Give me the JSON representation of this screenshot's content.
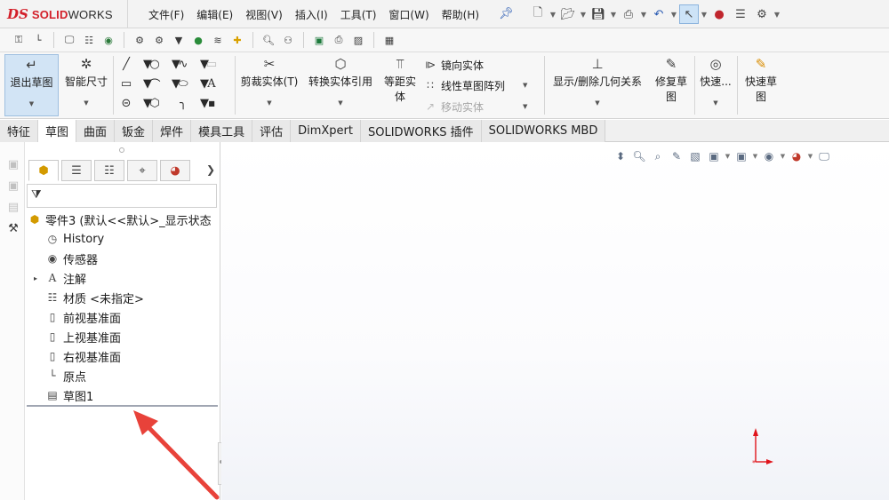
{
  "app": {
    "logo_ds": "DS",
    "logo_name_a": "SOLID",
    "logo_name_b": "WORKS"
  },
  "menu": [
    "文件(F)",
    "编辑(E)",
    "视图(V)",
    "插入(I)",
    "工具(T)",
    "窗口(W)",
    "帮助(H)"
  ],
  "quick_access_icons": [
    "new-icon",
    "open-icon",
    "save-icon",
    "print-icon",
    "undo-icon",
    "select-icon",
    "rebuild-icon",
    "file-properties-icon",
    "options-icon"
  ],
  "ribbon": {
    "exit_sketch": "退出草图",
    "smart_dimension": "智能尺寸",
    "trim_entities": "剪裁实体(T)",
    "convert_entities": "转换实体引用",
    "offset_entities": "等距实",
    "offset_entities_line2": "体",
    "mirror_entities": "镜向实体",
    "linear_pattern": "线性草图阵列",
    "move_entities": "移动实体",
    "display_delete_relations": "显示/删除几何关系",
    "repair_sketch": "修复草",
    "repair_sketch_line2": "图",
    "quick_snaps": "快速...",
    "rapid_sketch": "快速草",
    "rapid_sketch_line2": "图"
  },
  "tabs": [
    {
      "label": "特征",
      "active": false
    },
    {
      "label": "草图",
      "active": true
    },
    {
      "label": "曲面",
      "active": false
    },
    {
      "label": "钣金",
      "active": false
    },
    {
      "label": "焊件",
      "active": false
    },
    {
      "label": "模具工具",
      "active": false
    },
    {
      "label": "评估",
      "active": false
    },
    {
      "label": "DimXpert",
      "active": false
    },
    {
      "label": "SOLIDWORKS 插件",
      "active": false
    },
    {
      "label": "SOLIDWORKS MBD",
      "active": false
    }
  ],
  "tree": {
    "root": "零件3  (默认<<默认>_显示状态",
    "items": [
      {
        "label": "History",
        "icon": "history-icon"
      },
      {
        "label": "传感器",
        "icon": "sensor-icon"
      },
      {
        "label": "注解",
        "icon": "annotation-icon",
        "expandable": true
      },
      {
        "label": "材质 <未指定>",
        "icon": "material-icon"
      },
      {
        "label": "前视基准面",
        "icon": "plane-icon"
      },
      {
        "label": "上视基准面",
        "icon": "plane-icon"
      },
      {
        "label": "右视基准面",
        "icon": "plane-icon"
      },
      {
        "label": "原点",
        "icon": "origin-icon"
      },
      {
        "label": "草图1",
        "icon": "sketch-icon"
      }
    ]
  },
  "colors": {
    "brand": "#d3202a",
    "annotation_arrow": "#e8423a",
    "active_tool": "#d2e4f5"
  }
}
